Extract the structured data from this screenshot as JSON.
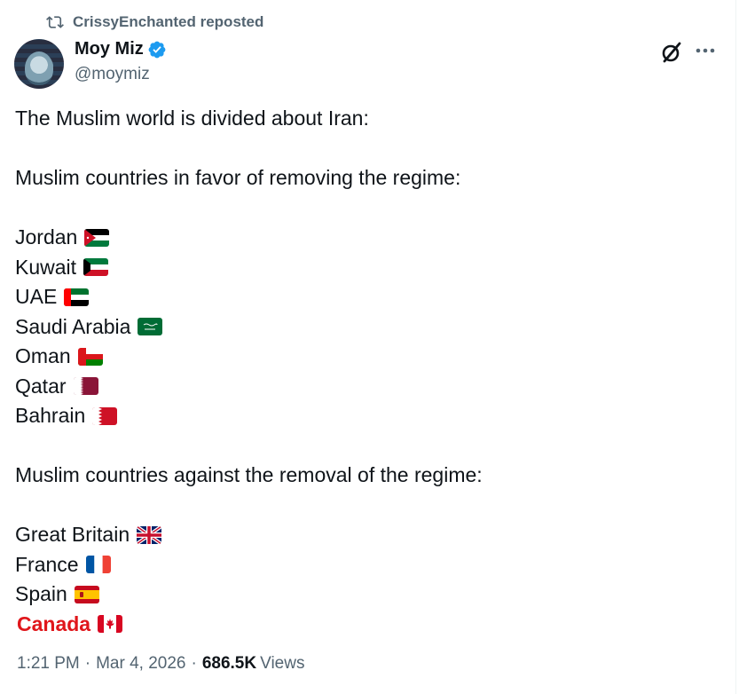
{
  "repost": {
    "text": "CrissyEnchanted reposted"
  },
  "author": {
    "name": "Moy Miz",
    "handle": "@moymiz",
    "verified": true
  },
  "tweet": {
    "intro": "The Muslim world is divided about Iran:",
    "in_favor_heading": "Muslim countries in favor of removing the regime:",
    "in_favor": [
      {
        "name": "Jordan",
        "flag": "jordan-flag"
      },
      {
        "name": "Kuwait",
        "flag": "kuwait-flag"
      },
      {
        "name": "UAE",
        "flag": "uae-flag"
      },
      {
        "name": "Saudi Arabia",
        "flag": "saudi-arabia-flag"
      },
      {
        "name": "Oman",
        "flag": "oman-flag"
      },
      {
        "name": "Qatar",
        "flag": "qatar-flag"
      },
      {
        "name": "Bahrain",
        "flag": "bahrain-flag"
      }
    ],
    "against_heading": "Muslim countries against the removal of the regime:",
    "against": [
      {
        "name": "Great Britain",
        "flag": "uk-flag"
      },
      {
        "name": "France",
        "flag": "france-flag"
      },
      {
        "name": "Spain",
        "flag": "spain-flag"
      },
      {
        "name": "Canada",
        "flag": "canada-flag",
        "highlight_color": "#e0161b"
      }
    ]
  },
  "meta": {
    "time": "1:21 PM",
    "separator": "·",
    "date": "Mar 4, 2026",
    "views_count": "686.5K",
    "views_label": "Views"
  },
  "colors": {
    "text": "#0f1419",
    "muted": "#536471",
    "verified_blue": "#1d9bf0",
    "canada_red": "#e0161b"
  }
}
